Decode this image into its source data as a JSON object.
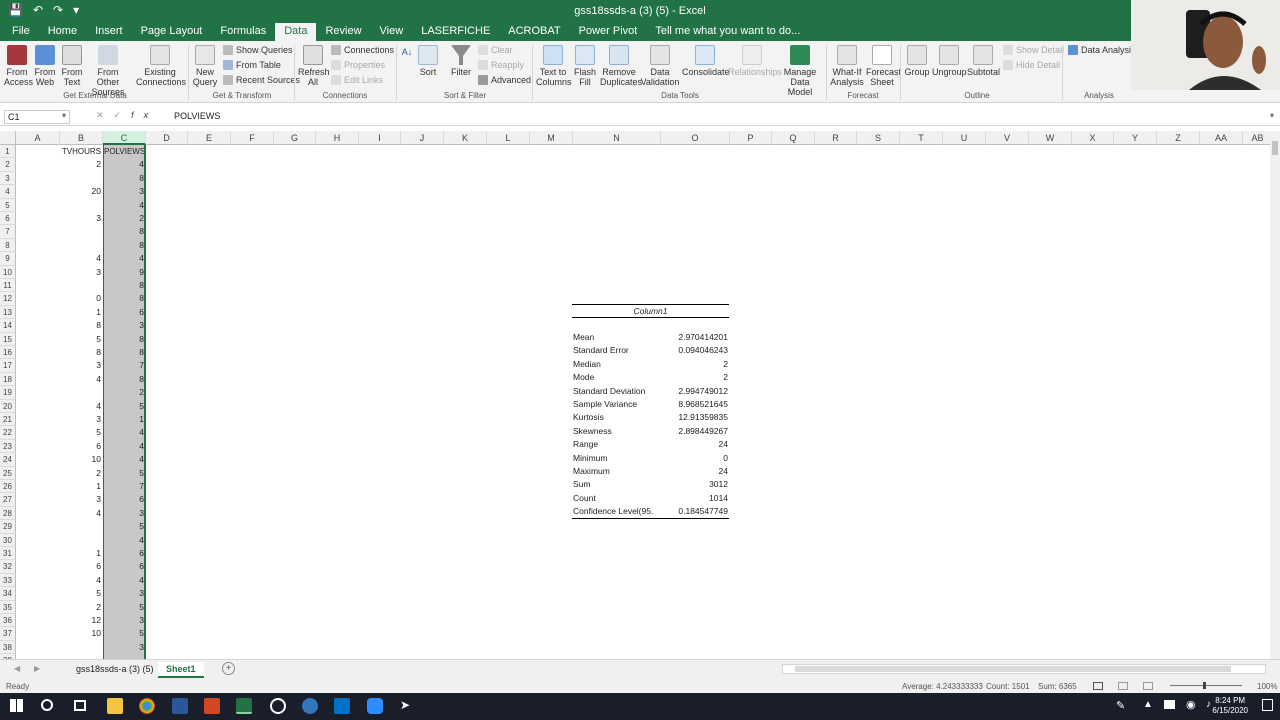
{
  "window": {
    "title": "gss18ssds-a (3) (5) - Excel"
  },
  "tabs": [
    {
      "label": "File"
    },
    {
      "label": "Home"
    },
    {
      "label": "Insert"
    },
    {
      "label": "Page Layout"
    },
    {
      "label": "Formulas"
    },
    {
      "label": "Data"
    },
    {
      "label": "Review"
    },
    {
      "label": "View"
    },
    {
      "label": "LASERFICHE"
    },
    {
      "label": "ACROBAT"
    },
    {
      "label": "Power Pivot"
    },
    {
      "label": "Tell me what you want to do..."
    }
  ],
  "ribbon": {
    "buttons": {
      "from_access": "From Access",
      "from_web": "From Web",
      "from_text": "From Text",
      "from_other": "From Other Sources",
      "existing": "Existing Connections",
      "new_query": "New Query",
      "refresh": "Refresh All",
      "sort": "Sort",
      "filter": "Filter",
      "text_to_columns": "Text to Columns",
      "flash_fill": "Flash Fill",
      "remove_duplicates": "Remove Duplicates",
      "data_validation": "Data Validation",
      "consolidate": "Consolidate",
      "relationships": "Relationships",
      "manage_model": "Manage Data Model",
      "whatif": "What-If Analysis",
      "forecast": "Forecast Sheet",
      "group": "Group",
      "ungroup": "Ungroup",
      "subtotal": "Subtotal",
      "data_analysis": "Data Analysis"
    },
    "small": {
      "show_queries": "Show Queries",
      "from_table": "From Table",
      "recent_sources": "Recent Sources",
      "connections": "Connections",
      "properties": "Properties",
      "edit_links": "Edit Links",
      "clear": "Clear",
      "reapply": "Reapply",
      "advanced": "Advanced",
      "show_detail": "Show Detail",
      "hide_detail": "Hide Detail"
    },
    "groups": {
      "external": "Get External Data",
      "transform": "Get & Transform",
      "connections": "Connections",
      "sortfilter": "Sort & Filter",
      "datatools": "Data Tools",
      "forecast": "Forecast",
      "outline": "Outline",
      "analysis": "Analysis"
    }
  },
  "formula_bar": {
    "name_box": "C1",
    "formula": "POLVIEWS"
  },
  "columns": [
    "A",
    "B",
    "C",
    "D",
    "E",
    "F",
    "G",
    "H",
    "I",
    "J",
    "K",
    "L",
    "M",
    "N",
    "O",
    "P",
    "Q",
    "R",
    "S",
    "T",
    "U",
    "V",
    "W",
    "X",
    "Y",
    "Z",
    "AA",
    "AB"
  ],
  "rows": [
    "1",
    "2",
    "3",
    "4",
    "5",
    "6",
    "7",
    "8",
    "9",
    "10",
    "11",
    "12",
    "13",
    "14",
    "15",
    "16",
    "17",
    "18",
    "19",
    "20",
    "21",
    "22",
    "23",
    "24",
    "25",
    "26",
    "27",
    "28",
    "29",
    "30",
    "31",
    "32",
    "33",
    "34",
    "35",
    "36",
    "37",
    "38",
    "39"
  ],
  "sheet": {
    "header_b": "TVHOURS",
    "header_c": "POLVIEWS",
    "col_b": [
      "2",
      "",
      "20",
      "",
      "3",
      "",
      "",
      "4",
      "3",
      "",
      "0",
      "1",
      "8",
      "5",
      "8",
      "3",
      "4",
      "",
      "4",
      "3",
      "5",
      "6",
      "10",
      "2",
      "1",
      "3",
      "4",
      "",
      "",
      "1",
      "6",
      "4",
      "5",
      "2",
      "12",
      "10",
      "",
      ""
    ],
    "col_c": [
      "4",
      "8",
      "3",
      "4",
      "2",
      "8",
      "8",
      "4",
      "9",
      "8",
      "8",
      "6",
      "3",
      "8",
      "8",
      "7",
      "8",
      "2",
      "5",
      "1",
      "4",
      "4",
      "4",
      "5",
      "7",
      "6",
      "3",
      "5",
      "4",
      "6",
      "6",
      "4",
      "3",
      "5",
      "3",
      "5",
      "3",
      ""
    ]
  },
  "stats": {
    "header": "Column1",
    "rows": [
      {
        "label": "Mean",
        "value": "2.970414201"
      },
      {
        "label": "Standard Error",
        "value": "0.094046243"
      },
      {
        "label": "Median",
        "value": "2"
      },
      {
        "label": "Mode",
        "value": "2"
      },
      {
        "label": "Standard Deviation",
        "value": "2.994749012"
      },
      {
        "label": "Sample Variance",
        "value": "8.968521645"
      },
      {
        "label": "Kurtosis",
        "value": "12.91359835"
      },
      {
        "label": "Skewness",
        "value": "2.898449267"
      },
      {
        "label": "Range",
        "value": "24"
      },
      {
        "label": "Minimum",
        "value": "0"
      },
      {
        "label": "Maximum",
        "value": "24"
      },
      {
        "label": "Sum",
        "value": "3012"
      },
      {
        "label": "Count",
        "value": "1014"
      },
      {
        "label": "Confidence Level(95.",
        "value": "0.184547749"
      }
    ]
  },
  "sheet_tabs": {
    "tab1": "gss18ssds-a (3) (5)",
    "tab2": "Sheet1"
  },
  "status": {
    "ready": "Ready",
    "average": "Average: 4.243333333",
    "count": "Count: 1501",
    "sum": "Sum: 6365",
    "zoom": "100%"
  },
  "taskbar": {
    "time": "8:24 PM",
    "date": "6/15/2020"
  },
  "colors": {
    "excel_green": "#217346",
    "selection": "#c8c8c8"
  }
}
